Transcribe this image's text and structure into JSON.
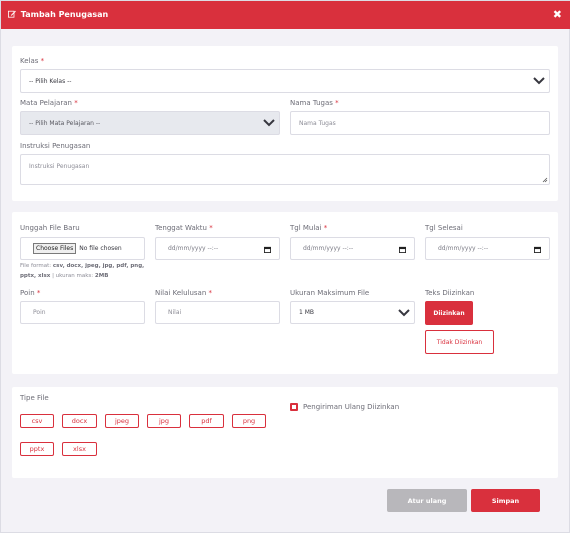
{
  "header": {
    "title": "Tambah Penugasan",
    "close_label": "✖"
  },
  "section1": {
    "kelas": {
      "label": "Kelas",
      "required": "*",
      "value": "-- Pilih Kelas --"
    },
    "mapel": {
      "label": "Mata Pelajaran",
      "required": "*",
      "value": "-- Pilih Mata Pelajaran --"
    },
    "nama_tugas": {
      "label": "Nama Tugas",
      "required": "*",
      "placeholder": "Nama Tugas"
    },
    "instruksi": {
      "label": "Instruksi Penugasan",
      "placeholder": "Instruksi Penugasan"
    }
  },
  "section2": {
    "upload": {
      "label": "Unggah File Baru",
      "button": "Choose Files",
      "status": "No file chosen",
      "help_prefix": "File format:",
      "help_formats": "csv, docx, jpeg, jpg, pdf, png, pptx, xlsx",
      "help_size_prefix": "| ukuran maks:",
      "help_size": "2MB"
    },
    "tenggat": {
      "label": "Tenggat Waktu",
      "required": "*",
      "placeholder": "dd/mm/yyyy --:--"
    },
    "tgl_mulai": {
      "label": "Tgl Mulai",
      "required": "*",
      "placeholder": "dd/mm/yyyy --:--"
    },
    "tgl_selesai": {
      "label": "Tgl Selesai",
      "placeholder": "dd/mm/yyyy --:--"
    },
    "poin": {
      "label": "Poin",
      "required": "*",
      "placeholder": "Poin"
    },
    "nilai": {
      "label": "Nilai Kelulusan",
      "required": "*",
      "placeholder": "Nilai"
    },
    "ukuran": {
      "label": "Ukuran Maksimum File",
      "value": "1 MB"
    },
    "teks": {
      "label": "Teks Diizinkan",
      "allow": "Diizinkan",
      "deny": "Tidak Diizinkan"
    }
  },
  "section3": {
    "tipe_label": "Tipe File",
    "types": [
      "csv",
      "docx",
      "jpeg",
      "jpg",
      "pdf",
      "png",
      "pptx",
      "xlsx"
    ],
    "resend_label": "Pengiriman Ulang Diizinkan"
  },
  "footer": {
    "reset": "Atur ulang",
    "save": "Simpan"
  },
  "colors": {
    "accent": "#d9303d",
    "background": "#f3f2f7",
    "reset_button": "#b8b7bb"
  }
}
